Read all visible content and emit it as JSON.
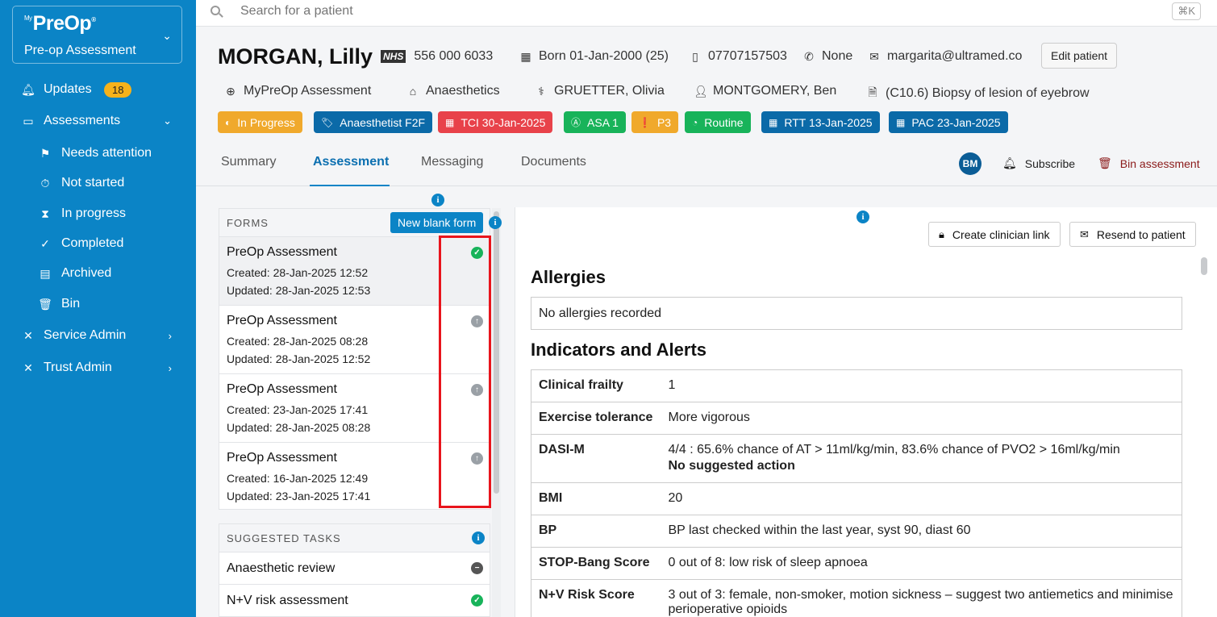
{
  "sidebar": {
    "brand_prefix": "My",
    "brand_name": "PreOp",
    "brand_tm": "®",
    "brand_subtitle": "Pre-op Assessment",
    "items": [
      {
        "label": "Updates",
        "icon": "bell-icon",
        "badge": "18"
      },
      {
        "label": "Assessments",
        "icon": "monitor-icon"
      },
      {
        "label": "Needs attention",
        "icon": "flag-icon"
      },
      {
        "label": "Not started",
        "icon": "stopwatch-icon"
      },
      {
        "label": "In progress",
        "icon": "hourglass-icon"
      },
      {
        "label": "Completed",
        "icon": "clipboard-check-icon"
      },
      {
        "label": "Archived",
        "icon": "archive-icon"
      },
      {
        "label": "Bin",
        "icon": "trash-icon"
      },
      {
        "label": "Service Admin",
        "icon": "tools-icon"
      },
      {
        "label": "Trust Admin",
        "icon": "tools-icon"
      }
    ]
  },
  "search": {
    "placeholder": "Search for a patient",
    "shortcut": "⌘K"
  },
  "patient": {
    "name": "MORGAN, Lilly",
    "nhs_label": "NHS",
    "nhs_number": "556 000 6033",
    "born": "Born 01-Jan-2000 (25)",
    "mobile": "07707157503",
    "phone": "None",
    "email": "margarita@ultramed.co",
    "edit_label": "Edit patient",
    "assessment_type": "MyPreOp Assessment",
    "specialty": "Anaesthetics",
    "clinician": "GRUETTER, Olivia",
    "consultant": "MONTGOMERY, Ben",
    "procedure": "(C10.6) Biopsy of lesion of eyebrow"
  },
  "tags": [
    {
      "label": "In Progress",
      "color": "#f0a92c"
    },
    {
      "label": "Anaesthetist F2F",
      "color": "#0b6aa8"
    },
    {
      "label": "TCI 30-Jan-2025",
      "color": "#e8424a"
    },
    {
      "label": "ASA 1",
      "color": "#18b35a"
    },
    {
      "label": "P3",
      "color": "#f0a92c"
    },
    {
      "label": "Routine",
      "color": "#18b35a"
    },
    {
      "label": "RTT 13-Jan-2025",
      "color": "#0b6aa8"
    },
    {
      "label": "PAC 23-Jan-2025",
      "color": "#0b6aa8"
    }
  ],
  "tabs": [
    "Summary",
    "Assessment",
    "Messaging",
    "Documents"
  ],
  "header_actions": {
    "avatar": "BM",
    "subscribe": "Subscribe",
    "bin": "Bin assessment",
    "bin_color": "#8b1a1a"
  },
  "forms": {
    "title": "FORMS",
    "new_label": "New blank form",
    "items": [
      {
        "title": "PreOp Assessment",
        "created": "Created: 28-Jan-2025 12:52",
        "updated": "Updated: 28-Jan-2025 12:53",
        "status": "complete"
      },
      {
        "title": "PreOp Assessment",
        "created": "Created: 28-Jan-2025 08:28",
        "updated": "Updated: 28-Jan-2025 12:52",
        "status": "submitted"
      },
      {
        "title": "PreOp Assessment",
        "created": "Created: 23-Jan-2025 17:41",
        "updated": "Updated: 28-Jan-2025 08:28",
        "status": "submitted"
      },
      {
        "title": "PreOp Assessment",
        "created": "Created: 16-Jan-2025 12:49",
        "updated": "Updated: 23-Jan-2025 17:41",
        "status": "submitted"
      }
    ]
  },
  "tasks": {
    "title": "SUGGESTED TASKS",
    "items": [
      {
        "label": "Anaesthetic review",
        "status": "not-required"
      },
      {
        "label": "N+V risk assessment",
        "status": "complete"
      }
    ]
  },
  "right": {
    "clinician_link": "Create clinician link",
    "resend": "Resend to patient",
    "allergies_title": "Allergies",
    "allergies_text": "No allergies recorded",
    "indicators_title": "Indicators and Alerts",
    "indicators": [
      {
        "label": "Clinical frailty",
        "value": "1"
      },
      {
        "label": "Exercise tolerance",
        "value": "More vigorous"
      },
      {
        "label": "DASI-M",
        "value": "4/4 : 65.6% chance of AT > 11ml/kg/min, 83.6% chance of PVO2 > 16ml/kg/min",
        "sub": "No suggested action"
      },
      {
        "label": "BMI",
        "value": "20"
      },
      {
        "label": "BP",
        "value": "BP last checked within the last year, syst 90, diast 60"
      },
      {
        "label": "STOP-Bang Score",
        "value": "0 out of 8: low risk of sleep apnoea"
      },
      {
        "label": "N+V Risk Score",
        "value": "3 out of 3: female, non-smoker, motion sickness – suggest two antiemetics and minimise perioperative opioids"
      }
    ]
  }
}
